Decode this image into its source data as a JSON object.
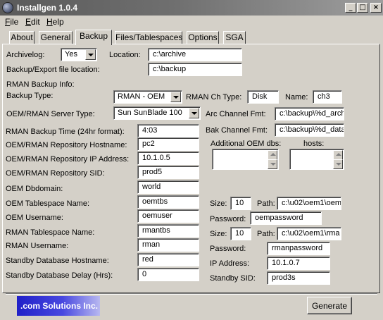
{
  "window": {
    "title": "Installgen 1.0.4",
    "min_glyph": "_",
    "max_glyph": "□",
    "close_glyph": "×"
  },
  "menu": {
    "file": "File",
    "edit": "Edit",
    "help": "Help"
  },
  "tabs": [
    "About",
    "General",
    "Backup",
    "Files/Tablespaces",
    "Options",
    "SGA"
  ],
  "active_tab": "Backup",
  "form": {
    "archivelog_label": "Archivelog:",
    "archivelog_value": "Yes",
    "location_label": "Location:",
    "location_value": "c:\\archive",
    "backup_export_label": "Backup/Export file location:",
    "backup_export_value": "c:\\backup",
    "rman_info_label": "RMAN Backup Info:",
    "backup_type_label": "Backup Type:",
    "backup_type_value": "RMAN - OEM",
    "rman_ch_type_label": "RMAN Ch Type:",
    "rman_ch_type_value": "Disk",
    "name_label": "Name:",
    "name_value": "ch3",
    "server_type_label": "OEM/RMAN Server Type:",
    "server_type_value": "Sun SunBlade 100",
    "arc_channel_label": "Arc Channel Fmt:",
    "arc_channel_value": "c:\\backup\\%d_arch",
    "bak_channel_label": "Bak Channel Fmt:",
    "bak_channel_value": "c:\\backup\\%d_data",
    "rman_time_label": "RMAN Backup Time (24hr format):",
    "rman_time_value": "4:03",
    "repo_hostname_label": "OEM/RMAN Repository Hostname:",
    "repo_hostname_value": "pc2",
    "repo_ip_label": "OEM/RMAN Repository IP Address:",
    "repo_ip_value": "10.1.0.5",
    "repo_sid_label": "OEM/RMAN Repository SID:",
    "repo_sid_value": "prod5",
    "additional_oem_label": "Additional OEM dbs:",
    "hosts_label": "hosts:",
    "oem_dbdomain_label": "OEM Dbdomain:",
    "oem_dbdomain_value": "world",
    "oem_tablespace_label": "OEM Tablespace Name:",
    "oem_tablespace_value": "oemtbs",
    "oem_size_label": "Size:",
    "oem_size_value": "10",
    "oem_path_label": "Path:",
    "oem_path_value": "c:\\u02\\oem1\\oem",
    "oem_username_label": "OEM Username:",
    "oem_username_value": "oemuser",
    "oem_password_label": "Password:",
    "oem_password_value": "oempassword",
    "rman_tablespace_label": "RMAN Tablespace Name:",
    "rman_tablespace_value": "rmantbs",
    "rman_size_label": "Size:",
    "rman_size_value": "10",
    "rman_path_label": "Path:",
    "rman_path_value": "c:\\u02\\oem1\\rma",
    "rman_username_label": "RMAN Username:",
    "rman_username_value": "rman",
    "rman_password_label": "Password:",
    "rman_password_value": "rmanpassword",
    "standby_hostname_label": "Standby Database Hostname:",
    "standby_hostname_value": "red",
    "standby_ip_label": "IP Address:",
    "standby_ip_value": "10.1.0.7",
    "standby_delay_label": "Standby Database Delay (Hrs):",
    "standby_delay_value": "0",
    "standby_sid_label": "Standby SID:",
    "standby_sid_value": "prod3s"
  },
  "footer": {
    "logo_text": ".com Solutions Inc.",
    "generate_label": "Generate"
  },
  "colors": {
    "window_bg": "#d4d0c8",
    "title_gradient_start": "#5a5a5a",
    "title_gradient_end": "#9e9e9e",
    "logo_blue": "#2020c8"
  }
}
